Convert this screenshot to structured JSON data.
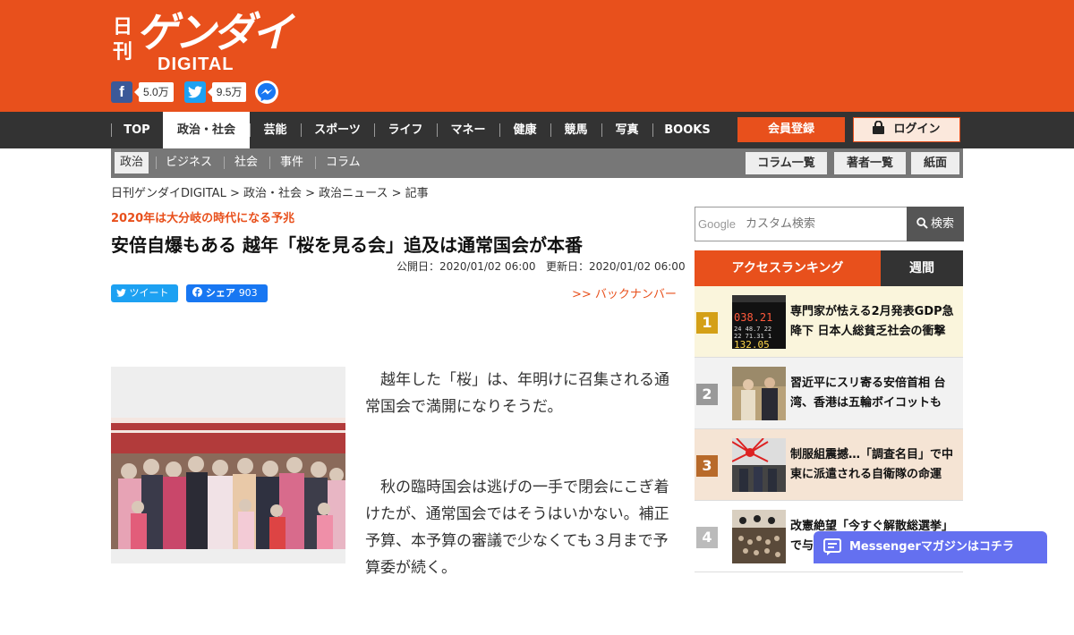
{
  "brand": {
    "logo_kanji": "日刊",
    "logo_kana": "ゲンダイ",
    "logo_latin": "DIGITAL",
    "accent_color": "#e8501c"
  },
  "social": {
    "facebook_icon": "facebook-icon",
    "facebook_count": "5.0万",
    "twitter_icon": "twitter-icon",
    "twitter_count": "9.5万",
    "messenger_icon": "messenger-icon"
  },
  "nav": {
    "items": [
      "TOP",
      "政治・社会",
      "芸能",
      "スポーツ",
      "ライフ",
      "マネー",
      "健康",
      "競馬",
      "写真",
      "BOOKS"
    ],
    "active": "政治・社会",
    "register_label": "会員登録",
    "login_label": "ログイン"
  },
  "subnav": {
    "items": [
      "政治",
      "ビジネス",
      "社会",
      "事件",
      "コラム"
    ],
    "active": "政治",
    "buttons": [
      "コラム一覧",
      "著者一覧",
      "紙面"
    ]
  },
  "breadcrumb": "日刊ゲンダイDIGITAL > 政治・社会 > 政治ニュース > 記事",
  "article": {
    "kicker": "2020年は大分岐の時代になる予兆",
    "title": "安倍自爆もある 越年「桜を見る会」追及は通常国会が本番",
    "published": "公開日：2020/01/02 06:00",
    "updated": "更新日：2020/01/02 06:00",
    "tweet_label": "ツイート",
    "share_label": "シェア",
    "share_count": "903",
    "backnumber_label": ">> バックナンバー",
    "paragraphs": [
      "越年した「桜」は、年明けに召集される通常国会で満開になりそうだ。",
      "秋の臨時国会は逃げの一手で閉会にこぎ着けたが、通常国会ではそうはいかない。補正予算、本予算の審議で少なくても３月まで予算委が続く。"
    ]
  },
  "search": {
    "google_mark": "Google",
    "placeholder": "カスタム検索",
    "button_label": "検索"
  },
  "ranking": {
    "tab_access": "アクセスランキング",
    "tab_weekly": "週間",
    "items": [
      {
        "rank": "1",
        "title": "専門家が怯える2月発表GDP急降下 日本人総貧乏社会の衝撃",
        "color": "#d4a017"
      },
      {
        "rank": "2",
        "title": "習近平にスリ寄る安倍首相 台湾、香港は五輪ボイコットも",
        "color": "#999999"
      },
      {
        "rank": "3",
        "title": "制服組震撼…「調査名目」で中東に派遣される自衛隊の命運",
        "color": "#b86a2a"
      },
      {
        "rank": "4",
        "title": "改憲絶望「今すぐ解散総選挙」で与",
        "color": "#bbbbbb"
      }
    ]
  },
  "messenger_bar": {
    "label": "Messengerマガジンはコチラ"
  }
}
